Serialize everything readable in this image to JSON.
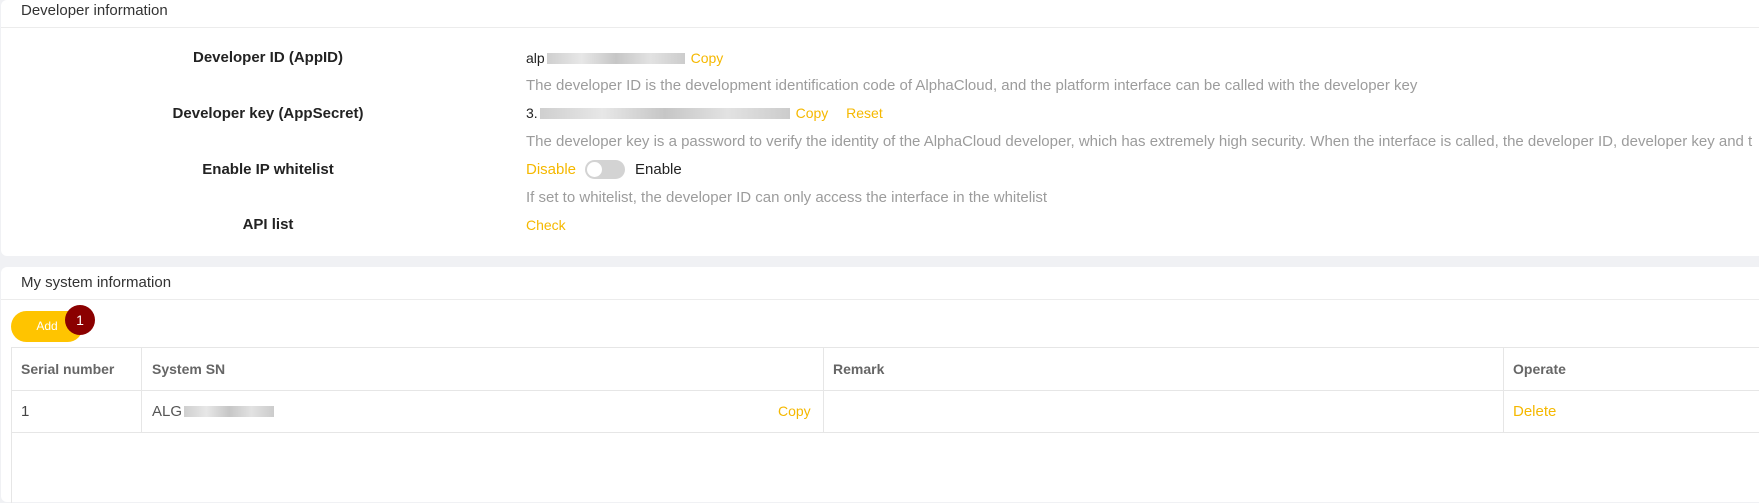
{
  "developer": {
    "title": "Developer information",
    "appid": {
      "label": "Developer ID (AppID)",
      "prefix": "alp",
      "copy": "Copy",
      "hint": "The developer ID is the development identification code of AlphaCloud, and the platform interface can be called with the developer key"
    },
    "appsecret": {
      "label": "Developer key (AppSecret)",
      "prefix": "3.",
      "copy": "Copy",
      "reset": "Reset",
      "hint": "The developer key is a password to verify the identity of the AlphaCloud developer, which has extremely high security. When the interface is called, the developer ID, developer key and t"
    },
    "whitelist": {
      "label": "Enable IP whitelist",
      "disable": "Disable",
      "enable": "Enable",
      "state": "off",
      "hint": "If set to whitelist, the developer ID can only access the interface in the whitelist"
    },
    "api": {
      "label": "API list",
      "check": "Check"
    }
  },
  "system": {
    "title": "My system information",
    "add": "Add",
    "badge": "1",
    "columns": [
      "Serial number",
      "System SN",
      "Remark",
      "Operate"
    ],
    "rows": [
      {
        "serial": "1",
        "sn_prefix": "ALG",
        "copy": "Copy",
        "remark": "",
        "operate": "Delete"
      }
    ]
  },
  "colors": {
    "accent": "#ffc400",
    "link": "#f5b800",
    "badge": "#8b0000",
    "hint": "#9c9c9c"
  },
  "icons": [
    "toggle-switch"
  ]
}
